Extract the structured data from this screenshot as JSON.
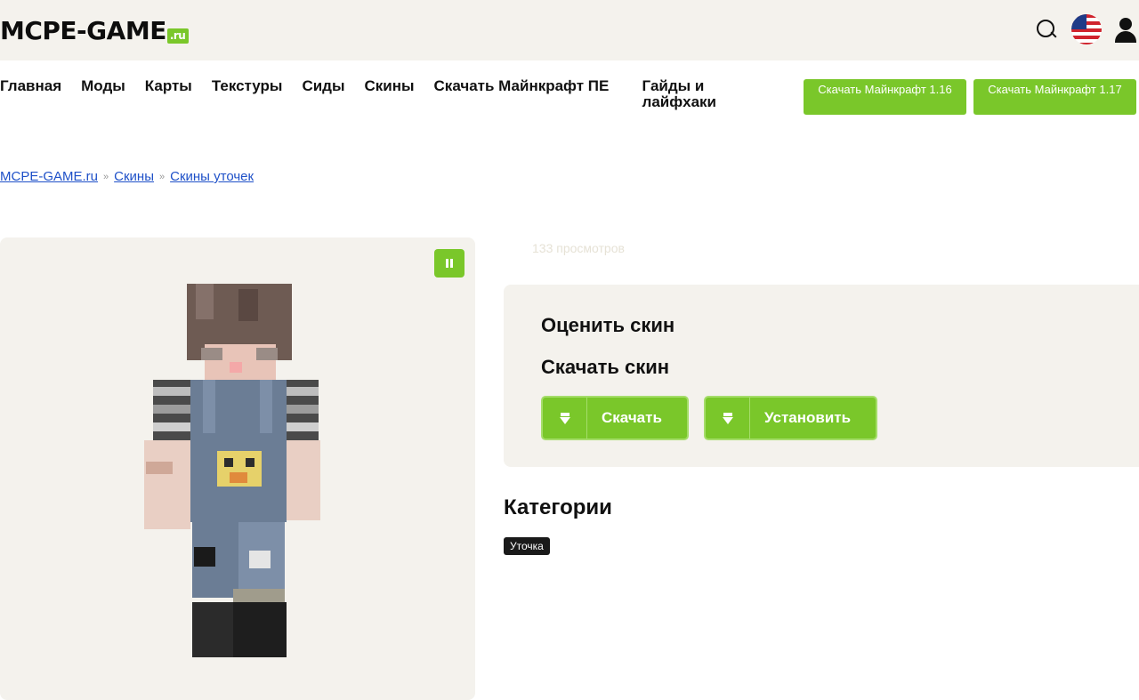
{
  "header": {
    "logo_text": "MCPE-GAME",
    "logo_suffix": ".ru"
  },
  "nav": {
    "items": [
      "Главная",
      "Моды",
      "Карты",
      "Текстуры",
      "Сиды",
      "Скины",
      "Скачать Майнкрафт ПЕ",
      "Гайды и лайфхаки"
    ],
    "download_buttons": [
      "Скачать Майнкрафт 1.16",
      "Скачать Майнкрафт 1.17"
    ]
  },
  "breadcrumb": {
    "items": [
      "MCPE-GAME.ru",
      "Скины",
      "Скины уточек"
    ],
    "separator": "»"
  },
  "skin": {
    "views": "133 просмотров",
    "rate_title": "Оценить скин",
    "download_title": "Скачать скин",
    "download_label": "Скачать",
    "install_label": "Установить"
  },
  "categories": {
    "title": "Категории",
    "tags": [
      "Уточка"
    ]
  },
  "colors": {
    "accent": "#7ac72a",
    "panel": "#f4f2ed",
    "link": "#1e50c8"
  }
}
